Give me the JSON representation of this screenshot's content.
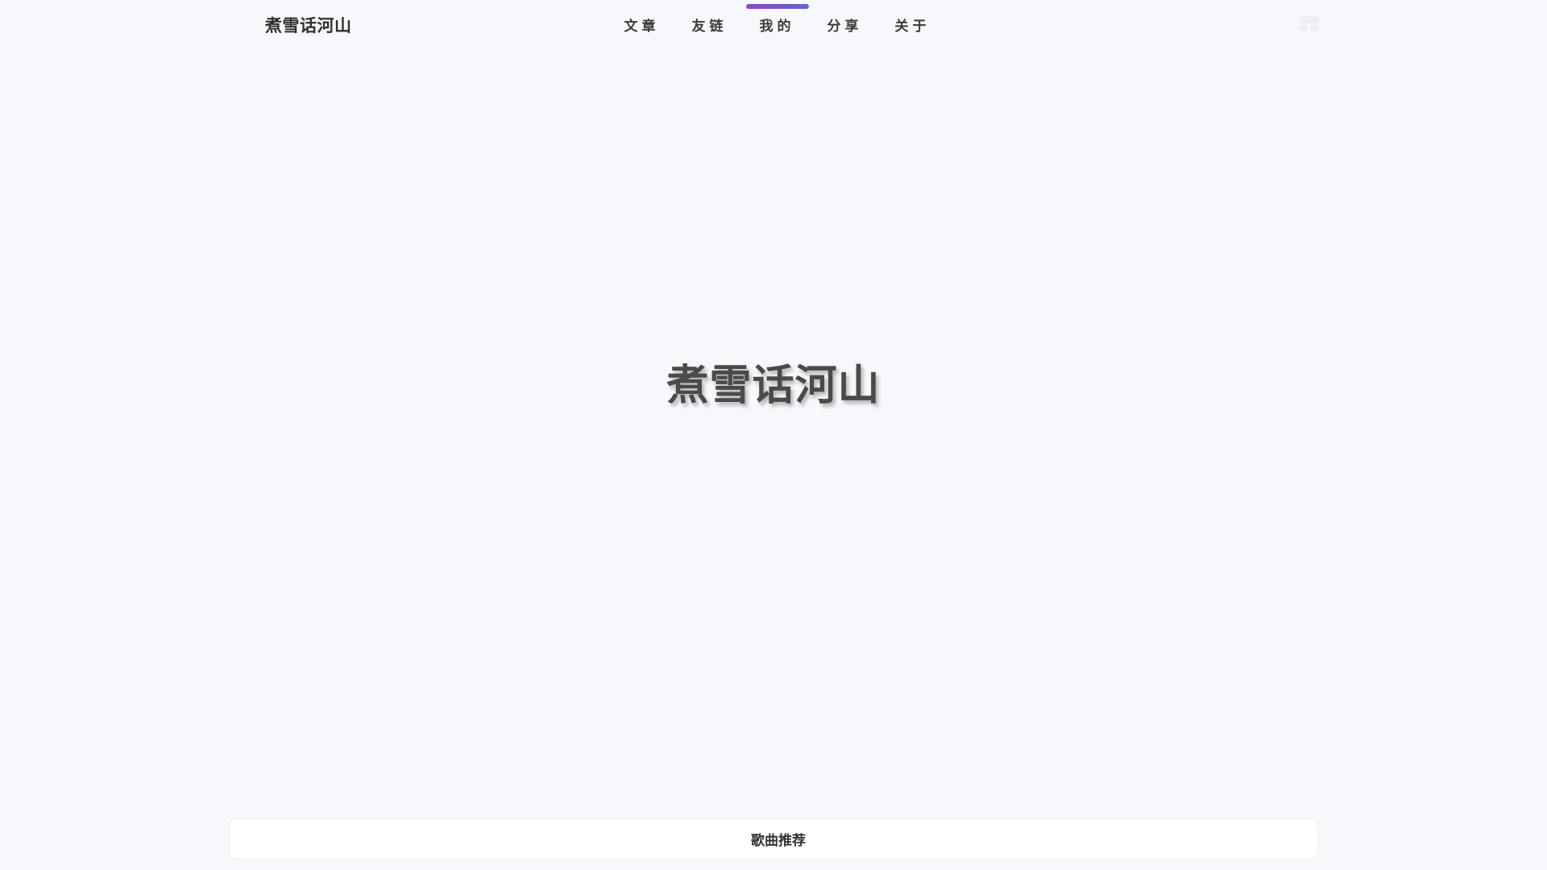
{
  "site": {
    "logo": "煮雪话河山"
  },
  "nav": {
    "items": [
      {
        "label": "文章"
      },
      {
        "label": "友链"
      },
      {
        "label": "我的"
      },
      {
        "label": "分享"
      },
      {
        "label": "关于"
      }
    ],
    "active_index": 2,
    "active_indicator_gradient": [
      "#8e44c9",
      "#5b63e0"
    ]
  },
  "header": {
    "menu_icon": "menu-grid-icon"
  },
  "hero": {
    "title": "煮雪话河山"
  },
  "footer": {
    "song_bar_label": "歌曲推荐"
  }
}
